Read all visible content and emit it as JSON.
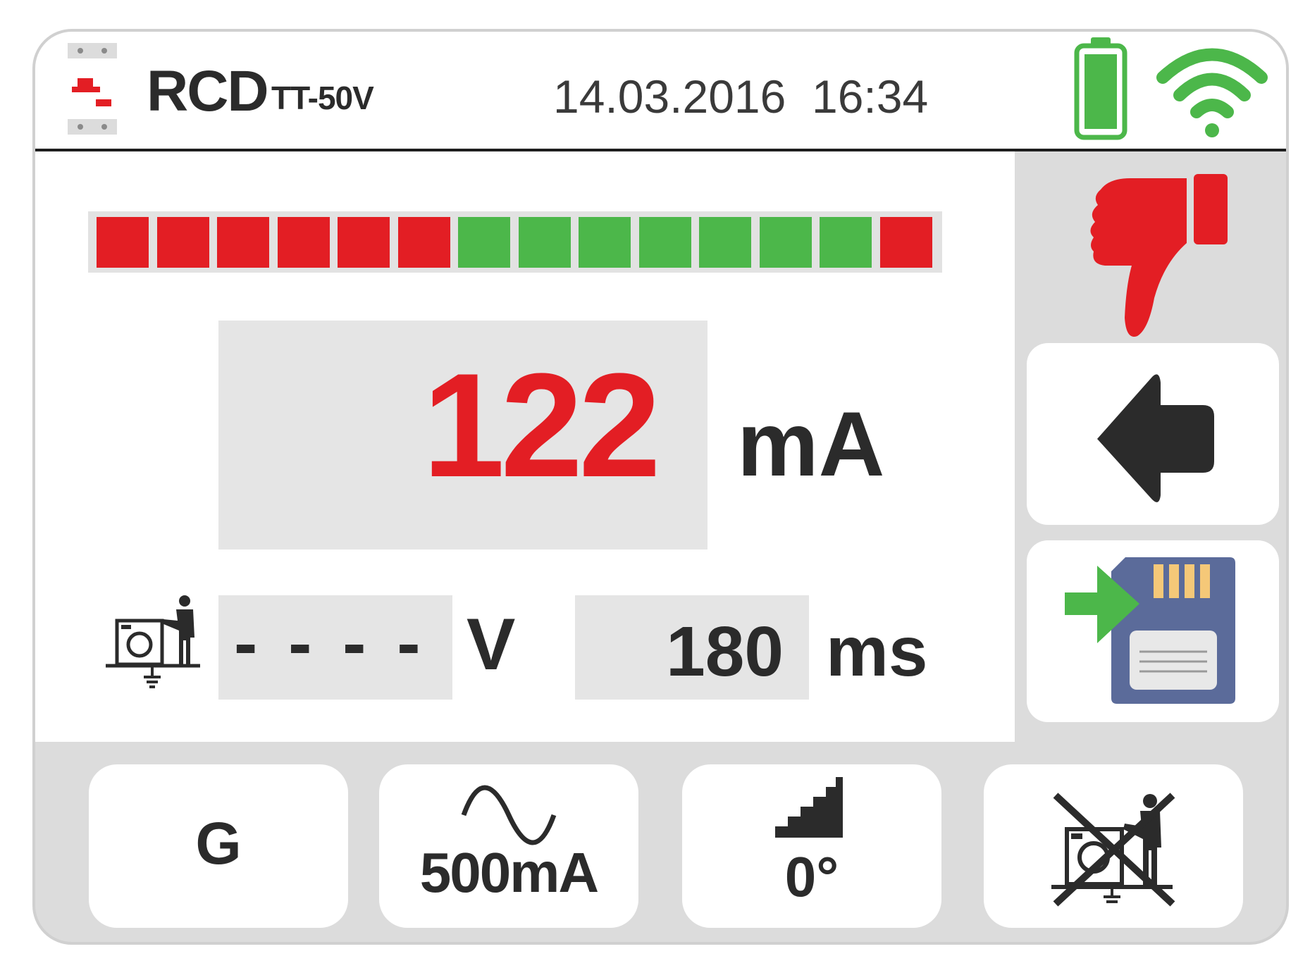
{
  "header": {
    "title": "RCD",
    "subtitle": "TT-50V",
    "date": "14.03.2016",
    "time": "16:34",
    "battery_icon": "battery-full-icon",
    "wifi_icon": "wifi-icon"
  },
  "level_bar": {
    "segments": [
      "red",
      "red",
      "red",
      "red",
      "red",
      "red",
      "green",
      "green",
      "green",
      "green",
      "green",
      "green",
      "green",
      "red"
    ],
    "colors": {
      "red": "#e31e24",
      "green": "#4cb74a",
      "track": "#e2e2e2"
    }
  },
  "result": {
    "value": "122",
    "unit": "mA",
    "value_color": "#e31e24"
  },
  "touch_voltage": {
    "icon": "touch-voltage-icon",
    "value": "- - - -",
    "unit": "V"
  },
  "trip_time": {
    "value": "180",
    "unit": "ms"
  },
  "verdict": {
    "icon": "thumbs-down-icon",
    "color": "#e31e24"
  },
  "side_buttons": {
    "back_icon": "back-arrow-icon",
    "save_icon": "save-to-memory-icon"
  },
  "bottom_buttons": {
    "type_label": "G",
    "current_waveform_icon": "sine-wave-icon",
    "current_label": "500mA",
    "phase_icon": "staircase-icon",
    "phase_label": "0°",
    "touch_voltage_off_icon": "touch-voltage-off-icon"
  }
}
